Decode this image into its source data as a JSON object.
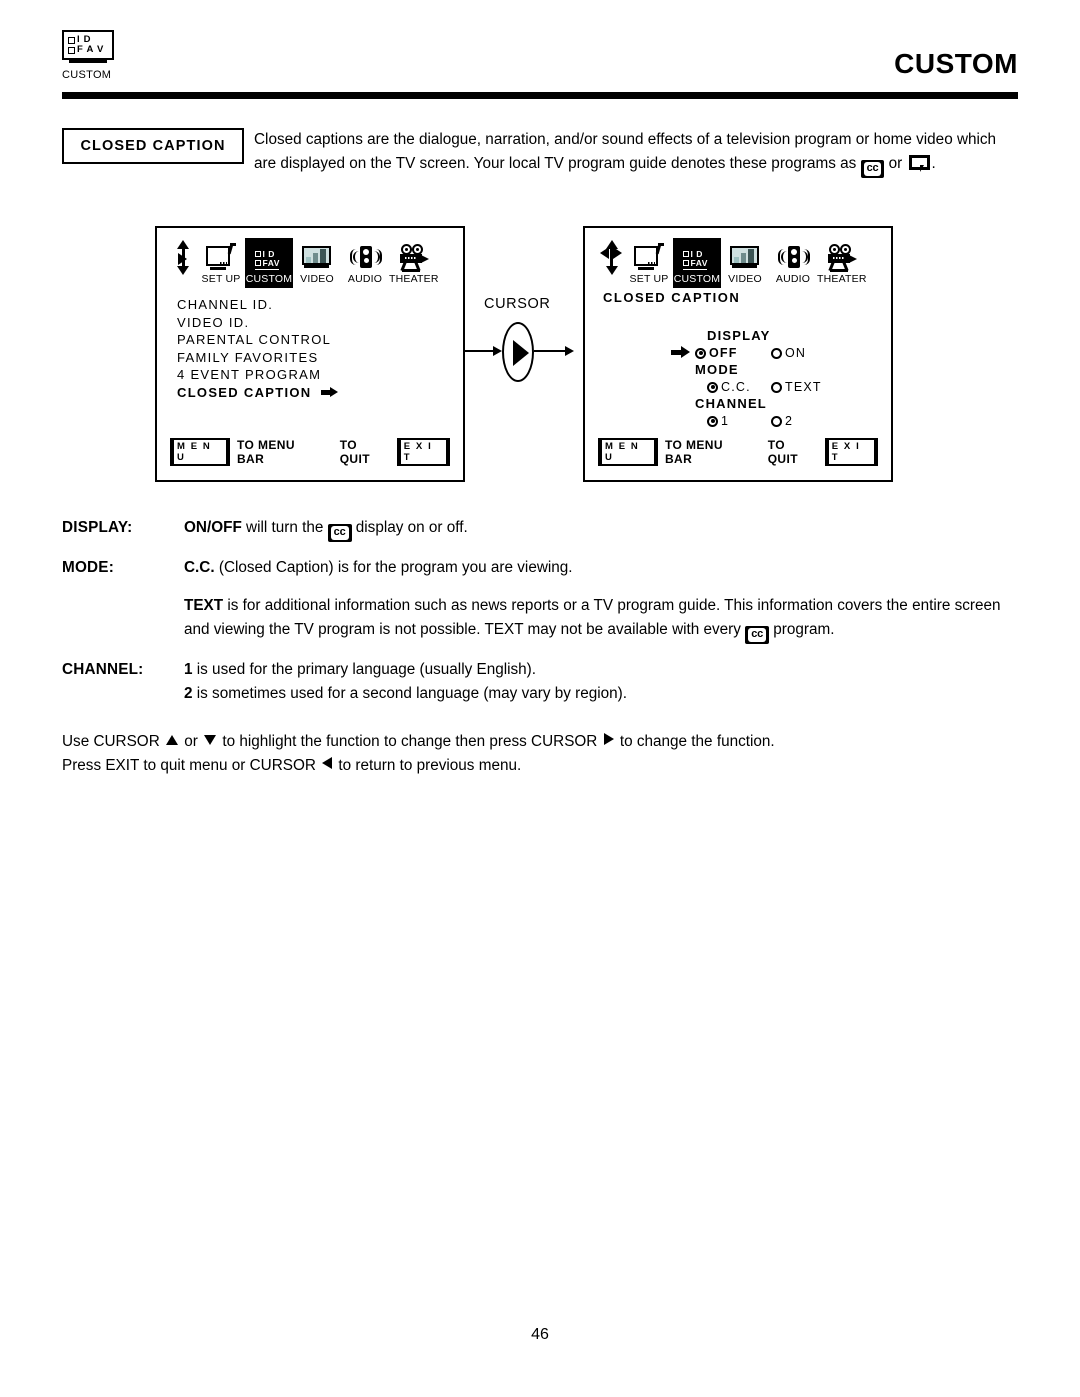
{
  "header": {
    "logo_line1": "I D",
    "logo_line2": "F A V",
    "logo_caption": "CUSTOM",
    "title": "CUSTOM"
  },
  "intro": {
    "label": "CLOSED CAPTION",
    "text_part1": "Closed captions are the dialogue, narration, and/or sound effects of a television program or home video which are displayed on the TV screen.  Your local TV program guide denotes these programs as ",
    "cc_badge": "cc",
    "text_part2": " or ",
    "text_part3": "."
  },
  "menu_bar": {
    "items": [
      {
        "label": "SET UP",
        "icon": "monitor-antenna-icon",
        "selected": false
      },
      {
        "label": "CUSTOM",
        "icon": "id-fav-icon",
        "selected": true
      },
      {
        "label": "VIDEO",
        "icon": "video-bars-icon",
        "selected": false
      },
      {
        "label": "AUDIO",
        "icon": "speaker-icon",
        "selected": false
      },
      {
        "label": "THEATER",
        "icon": "film-camera-icon",
        "selected": false
      }
    ],
    "custom_icon_line1": "I D",
    "custom_icon_line2": "FAV"
  },
  "osd_left": {
    "items": [
      {
        "label": "CHANNEL ID.",
        "highlighted": false
      },
      {
        "label": "VIDEO ID.",
        "highlighted": false
      },
      {
        "label": "PARENTAL CONTROL",
        "highlighted": false
      },
      {
        "label": "FAMILY FAVORITES",
        "highlighted": false
      },
      {
        "label": "4 EVENT PROGRAM",
        "highlighted": false
      },
      {
        "label": "CLOSED CAPTION",
        "highlighted": true
      }
    ],
    "footer": {
      "menu_key": "M E N U",
      "menu_text": "TO MENU BAR",
      "quit_text": "TO QUIT",
      "exit_key": "E X I T"
    }
  },
  "osd_right": {
    "title": "CLOSED CAPTION",
    "groups": [
      {
        "title": "DISPLAY",
        "cursor": true,
        "options": [
          {
            "label": "OFF",
            "selected": true,
            "bold": true
          },
          {
            "label": "ON",
            "selected": false,
            "bold": false
          }
        ]
      },
      {
        "title": "MODE",
        "cursor": false,
        "options": [
          {
            "label": "C.C.",
            "selected": true,
            "bold": false
          },
          {
            "label": "TEXT",
            "selected": false,
            "bold": false
          }
        ]
      },
      {
        "title": "CHANNEL",
        "cursor": false,
        "options": [
          {
            "label": "1",
            "selected": true,
            "bold": false
          },
          {
            "label": "2",
            "selected": false,
            "bold": false
          }
        ]
      }
    ],
    "footer": {
      "menu_key": "M E N U",
      "menu_text": "TO MENU BAR",
      "quit_text": "TO QUIT",
      "exit_key": "E X I T"
    }
  },
  "cursor_connector": {
    "label": "CURSOR"
  },
  "definitions": [
    {
      "term": "DISPLAY:",
      "lead": "ON/OFF",
      "after_lead": " will turn the ",
      "badge": "cc",
      "tail": " display on or off."
    },
    {
      "term": "MODE:",
      "lead": "C.C.",
      "after_lead": " (Closed Caption) is for the program you are viewing.",
      "badge": null,
      "tail": ""
    }
  ],
  "text_paragraph": {
    "lead": "TEXT",
    "part1": " is for additional information such as news reports or a TV program guide.  This information covers the entire screen and viewing the TV program is not possible.  TEXT may not be available with every ",
    "badge": "cc",
    "part2": " program."
  },
  "channel_definition": {
    "term": "CHANNEL:",
    "line1_lead": "1",
    "line1": " is used for the primary language (usually English).",
    "line2_lead": "2",
    "line2": " is sometimes used for a second language (may vary by region)."
  },
  "usage_note": {
    "l1_a": "Use CURSOR ",
    "l1_b": " or ",
    "l1_c": " to highlight the function to change then press CURSOR ",
    "l1_d": " to change the function.",
    "l2_a": "Press EXIT to quit menu or CURSOR ",
    "l2_b": " to return to previous menu."
  },
  "page_number": "46",
  "colors": {
    "ink": "#000000",
    "paper": "#ffffff"
  }
}
